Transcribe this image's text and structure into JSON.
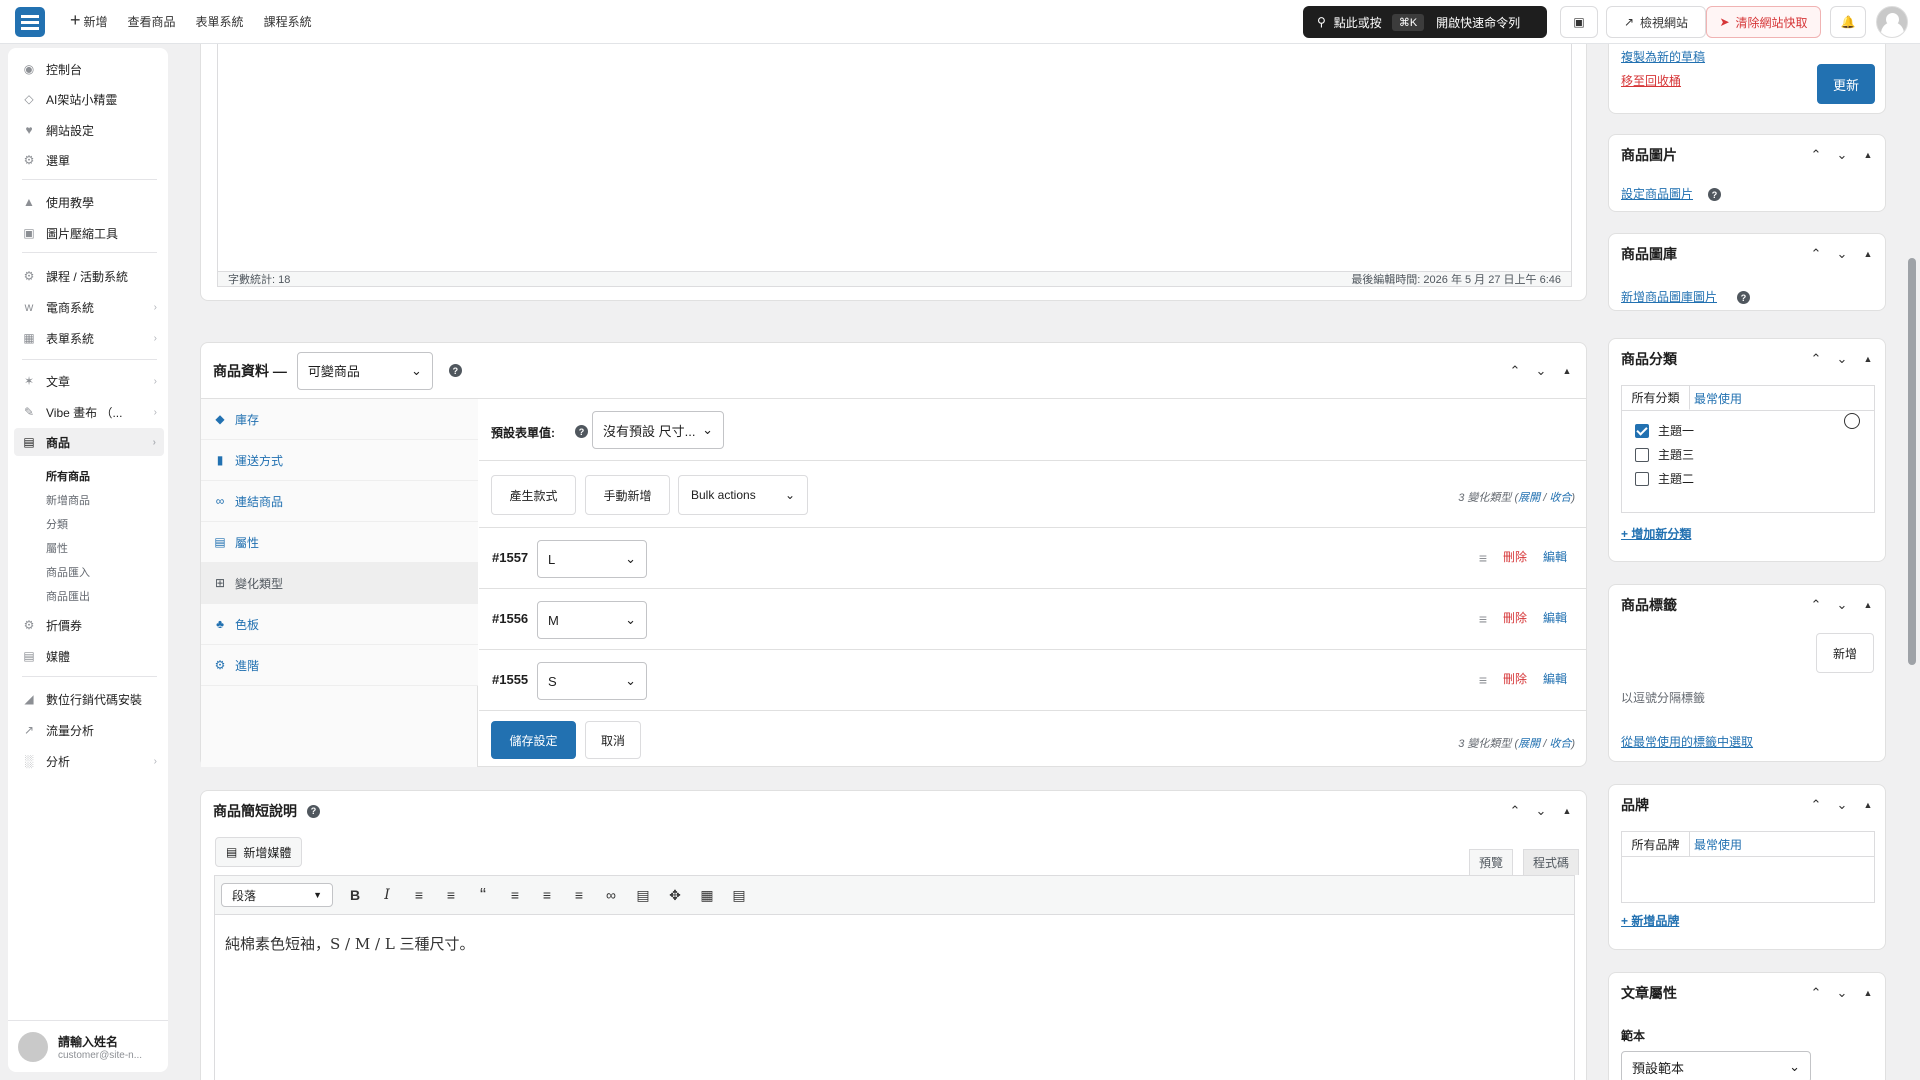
{
  "topbar": {
    "new_label": "新增",
    "links": [
      "查看商品",
      "表單系統",
      "課程系統"
    ],
    "command": {
      "label": "點此或按",
      "shortcut": "⌘K",
      "label2": "開啟快速命令列"
    },
    "view_site": "檢視網站",
    "clear_cache": "清除網站快取"
  },
  "sidebar": {
    "items": [
      {
        "label": "控制台",
        "icon": "dashboard-icon"
      },
      {
        "label": "AI架站小精靈",
        "icon": "ai-icon"
      },
      {
        "label": "網站設定",
        "icon": "heart-icon"
      },
      {
        "label": "選單",
        "icon": "gear-icon"
      },
      {
        "label": "使用教學",
        "icon": "graduation-icon"
      },
      {
        "label": "圖片壓縮工具",
        "icon": "image-icon"
      },
      {
        "label": "課程 / 活動系統",
        "icon": "gear-icon"
      },
      {
        "label": "電商系統",
        "icon": "woo-icon"
      },
      {
        "label": "表單系統",
        "icon": "form-icon"
      },
      {
        "label": "文章",
        "icon": "pin-icon"
      },
      {
        "label": "Vibe 畫布 （...",
        "icon": "brush-icon"
      },
      {
        "label": "商品",
        "icon": "box-icon"
      },
      {
        "label": "折價券",
        "icon": "gear-icon"
      },
      {
        "label": "媒體",
        "icon": "media-icon"
      },
      {
        "label": "數位行銷代碼安裝",
        "icon": "chart-icon"
      },
      {
        "label": "流量分析",
        "icon": "line-icon"
      },
      {
        "label": "分析",
        "icon": "bar-icon"
      }
    ],
    "product_sub": [
      "所有商品",
      "新增商品",
      "分類",
      "屬性",
      "商品匯入",
      "商品匯出"
    ],
    "user": {
      "name": "請輸入姓名",
      "email": "customer@site-n..."
    }
  },
  "editor": {
    "word_count": "字數統計: 18",
    "last_edit": "最後編輯時間: 2026 年 5 月 27 日上午 6:46"
  },
  "product_data": {
    "title": "商品資料 —",
    "type": "可變商品",
    "tabs": [
      {
        "label": "庫存",
        "icon": "tag-icon"
      },
      {
        "label": "運送方式",
        "icon": "truck-icon"
      },
      {
        "label": "連結商品",
        "icon": "link-icon"
      },
      {
        "label": "屬性",
        "icon": "list-icon"
      },
      {
        "label": "變化類型",
        "icon": "grid-icon"
      },
      {
        "label": "色板",
        "icon": "swatch-icon"
      },
      {
        "label": "進階",
        "icon": "gear-icon"
      }
    ],
    "default_label": "預設表單值:",
    "default_value": "沒有預設 尺寸...",
    "buttons": {
      "generate": "產生款式",
      "manual": "手動新增",
      "bulk": "Bulk actions"
    },
    "variations_count": "3 變化類型",
    "expand": "展開",
    "collapse": "收合",
    "variations": [
      {
        "id": "#1557",
        "value": "L"
      },
      {
        "id": "#1556",
        "value": "M"
      },
      {
        "id": "#1555",
        "value": "S"
      }
    ],
    "delete_label": "刪除",
    "edit_label": "編輯",
    "save": "儲存設定",
    "cancel": "取消"
  },
  "short_desc": {
    "title": "商品簡短說明",
    "add_media": "新增媒體",
    "tab_visual": "預覽",
    "tab_code": "程式碼",
    "format": "段落",
    "content": "純棉素色短袖，S / M / L 三種尺寸。"
  },
  "publish": {
    "copy_draft": "複製為新的草稿",
    "trash": "移至回收桶",
    "update": "更新"
  },
  "product_image": {
    "title": "商品圖片",
    "link": "設定商品圖片"
  },
  "gallery": {
    "title": "商品圖庫",
    "link": "新增商品圖庫圖片"
  },
  "categories": {
    "title": "商品分類",
    "tab_all": "所有分類",
    "tab_popular": "最常使用",
    "items": [
      {
        "label": "主題一",
        "checked": true
      },
      {
        "label": "主題三",
        "checked": false
      },
      {
        "label": "主題二",
        "checked": false
      }
    ],
    "add": "+ 增加新分類"
  },
  "tags": {
    "title": "商品標籤",
    "add_btn": "新增",
    "hint": "以逗號分隔標籤",
    "choose": "從最常使用的標籤中選取"
  },
  "brand": {
    "title": "品牌",
    "tab_all": "所有品牌",
    "tab_popular": "最常使用",
    "add": "+ 新增品牌"
  },
  "attributes": {
    "title": "文章屬性",
    "template_label": "範本",
    "template_value": "預設範本"
  }
}
